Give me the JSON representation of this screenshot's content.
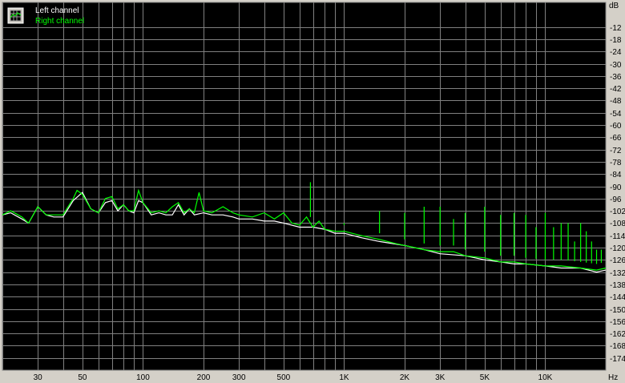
{
  "chart_data": {
    "type": "line",
    "y_unit": "dB",
    "x_unit": "Hz",
    "x_scale": "log",
    "xlim": [
      20,
      20000
    ],
    "ylim": [
      -180,
      0
    ],
    "grid": true,
    "legend_position": "top-left",
    "background_color": "#000000",
    "grid_color": "#808080",
    "x_ticks": [
      {
        "value": 30,
        "label": "30"
      },
      {
        "value": 50,
        "label": "50"
      },
      {
        "value": 100,
        "label": "100"
      },
      {
        "value": 200,
        "label": "200"
      },
      {
        "value": 300,
        "label": "300"
      },
      {
        "value": 500,
        "label": "500"
      },
      {
        "value": 1000,
        "label": "1K"
      },
      {
        "value": 2000,
        "label": "2K"
      },
      {
        "value": 3000,
        "label": "3K"
      },
      {
        "value": 5000,
        "label": "5K"
      },
      {
        "value": 10000,
        "label": "10K"
      }
    ],
    "x_minor": [
      20,
      40,
      60,
      70,
      80,
      90,
      400,
      600,
      700,
      800,
      900,
      4000,
      6000,
      7000,
      8000,
      9000
    ],
    "y_ticks": [
      -12,
      -18,
      -24,
      -30,
      -36,
      -42,
      -48,
      -54,
      -60,
      -66,
      -72,
      -78,
      -84,
      -90,
      -96,
      -102,
      -108,
      -114,
      -120,
      -126,
      -132,
      -138,
      -144,
      -150,
      -156,
      -162,
      -168,
      -174
    ],
    "series": [
      {
        "name": "Left channel",
        "color": "#ffffff",
        "points": [
          [
            20,
            -104
          ],
          [
            22,
            -103
          ],
          [
            25,
            -106
          ],
          [
            27,
            -108
          ],
          [
            30,
            -100
          ],
          [
            33,
            -104
          ],
          [
            36,
            -105
          ],
          [
            40,
            -105
          ],
          [
            45,
            -97
          ],
          [
            50,
            -93
          ],
          [
            55,
            -101
          ],
          [
            60,
            -103
          ],
          [
            65,
            -98
          ],
          [
            70,
            -97
          ],
          [
            75,
            -102
          ],
          [
            80,
            -99
          ],
          [
            85,
            -102
          ],
          [
            90,
            -103
          ],
          [
            95,
            -97
          ],
          [
            100,
            -98
          ],
          [
            110,
            -104
          ],
          [
            120,
            -103
          ],
          [
            130,
            -104
          ],
          [
            140,
            -104
          ],
          [
            150,
            -99
          ],
          [
            160,
            -104
          ],
          [
            170,
            -101
          ],
          [
            180,
            -104
          ],
          [
            200,
            -103
          ],
          [
            220,
            -104
          ],
          [
            250,
            -104
          ],
          [
            280,
            -105
          ],
          [
            300,
            -106
          ],
          [
            350,
            -106
          ],
          [
            400,
            -107
          ],
          [
            450,
            -107
          ],
          [
            500,
            -108
          ],
          [
            600,
            -110
          ],
          [
            700,
            -110
          ],
          [
            800,
            -111
          ],
          [
            900,
            -113
          ],
          [
            1000,
            -113
          ],
          [
            1200,
            -115
          ],
          [
            1500,
            -117
          ],
          [
            2000,
            -119
          ],
          [
            2500,
            -121
          ],
          [
            3000,
            -123
          ],
          [
            4000,
            -124
          ],
          [
            5000,
            -126
          ],
          [
            6000,
            -127
          ],
          [
            7000,
            -128
          ],
          [
            8000,
            -128
          ],
          [
            10000,
            -129
          ],
          [
            12000,
            -130
          ],
          [
            15000,
            -130
          ],
          [
            18000,
            -132
          ],
          [
            20000,
            -131
          ]
        ]
      },
      {
        "name": "Right channel",
        "color": "#00ff00",
        "points": [
          [
            20,
            -104
          ],
          [
            22,
            -102
          ],
          [
            25,
            -105
          ],
          [
            27,
            -108
          ],
          [
            30,
            -100
          ],
          [
            33,
            -104
          ],
          [
            36,
            -104
          ],
          [
            40,
            -104
          ],
          [
            45,
            -96
          ],
          [
            47,
            -92
          ],
          [
            50,
            -94
          ],
          [
            55,
            -101
          ],
          [
            60,
            -103
          ],
          [
            65,
            -96
          ],
          [
            70,
            -95
          ],
          [
            75,
            -101
          ],
          [
            80,
            -99
          ],
          [
            85,
            -102
          ],
          [
            90,
            -102
          ],
          [
            95,
            -92
          ],
          [
            100,
            -98
          ],
          [
            110,
            -103
          ],
          [
            120,
            -102
          ],
          [
            130,
            -103
          ],
          [
            140,
            -100
          ],
          [
            150,
            -98
          ],
          [
            160,
            -103
          ],
          [
            170,
            -101
          ],
          [
            180,
            -103
          ],
          [
            190,
            -93
          ],
          [
            200,
            -102
          ],
          [
            220,
            -103
          ],
          [
            250,
            -100
          ],
          [
            280,
            -103
          ],
          [
            300,
            -104
          ],
          [
            350,
            -105
          ],
          [
            400,
            -103
          ],
          [
            450,
            -106
          ],
          [
            500,
            -103
          ],
          [
            550,
            -108
          ],
          [
            600,
            -109
          ],
          [
            650,
            -105
          ],
          [
            700,
            -110
          ],
          [
            750,
            -107
          ],
          [
            800,
            -111
          ],
          [
            900,
            -112
          ],
          [
            1000,
            -112
          ],
          [
            1200,
            -114
          ],
          [
            1500,
            -116
          ],
          [
            1800,
            -118
          ],
          [
            2000,
            -119
          ],
          [
            2500,
            -121
          ],
          [
            3000,
            -122
          ],
          [
            3500,
            -122
          ],
          [
            4000,
            -124
          ],
          [
            5000,
            -125
          ],
          [
            6000,
            -127
          ],
          [
            7000,
            -127
          ],
          [
            8000,
            -128
          ],
          [
            10000,
            -129
          ],
          [
            12000,
            -129
          ],
          [
            15000,
            -130
          ],
          [
            18000,
            -131
          ],
          [
            20000,
            -130
          ]
        ]
      }
    ],
    "spikes": [
      {
        "x": 680,
        "y": -88
      },
      {
        "x": 1000,
        "y": -108
      },
      {
        "x": 1500,
        "y": -102
      },
      {
        "x": 2000,
        "y": -103
      },
      {
        "x": 2500,
        "y": -100
      },
      {
        "x": 3000,
        "y": -100
      },
      {
        "x": 3500,
        "y": -106
      },
      {
        "x": 4000,
        "y": -103
      },
      {
        "x": 5000,
        "y": -100
      },
      {
        "x": 6000,
        "y": -104
      },
      {
        "x": 7000,
        "y": -103
      },
      {
        "x": 8000,
        "y": -104
      },
      {
        "x": 9000,
        "y": -110
      },
      {
        "x": 10000,
        "y": -103
      },
      {
        "x": 11000,
        "y": -110
      },
      {
        "x": 12000,
        "y": -108
      },
      {
        "x": 13000,
        "y": -108
      },
      {
        "x": 14000,
        "y": -117
      },
      {
        "x": 15000,
        "y": -108
      },
      {
        "x": 16000,
        "y": -112
      },
      {
        "x": 17000,
        "y": -117
      },
      {
        "x": 18000,
        "y": -121
      },
      {
        "x": 19000,
        "y": -121
      }
    ],
    "legend": [
      {
        "label": "Left channel",
        "color": "#ffffff"
      },
      {
        "label": "Right channel",
        "color": "#00ff00"
      }
    ]
  },
  "legend_icon": "spectrum-grid-icon"
}
